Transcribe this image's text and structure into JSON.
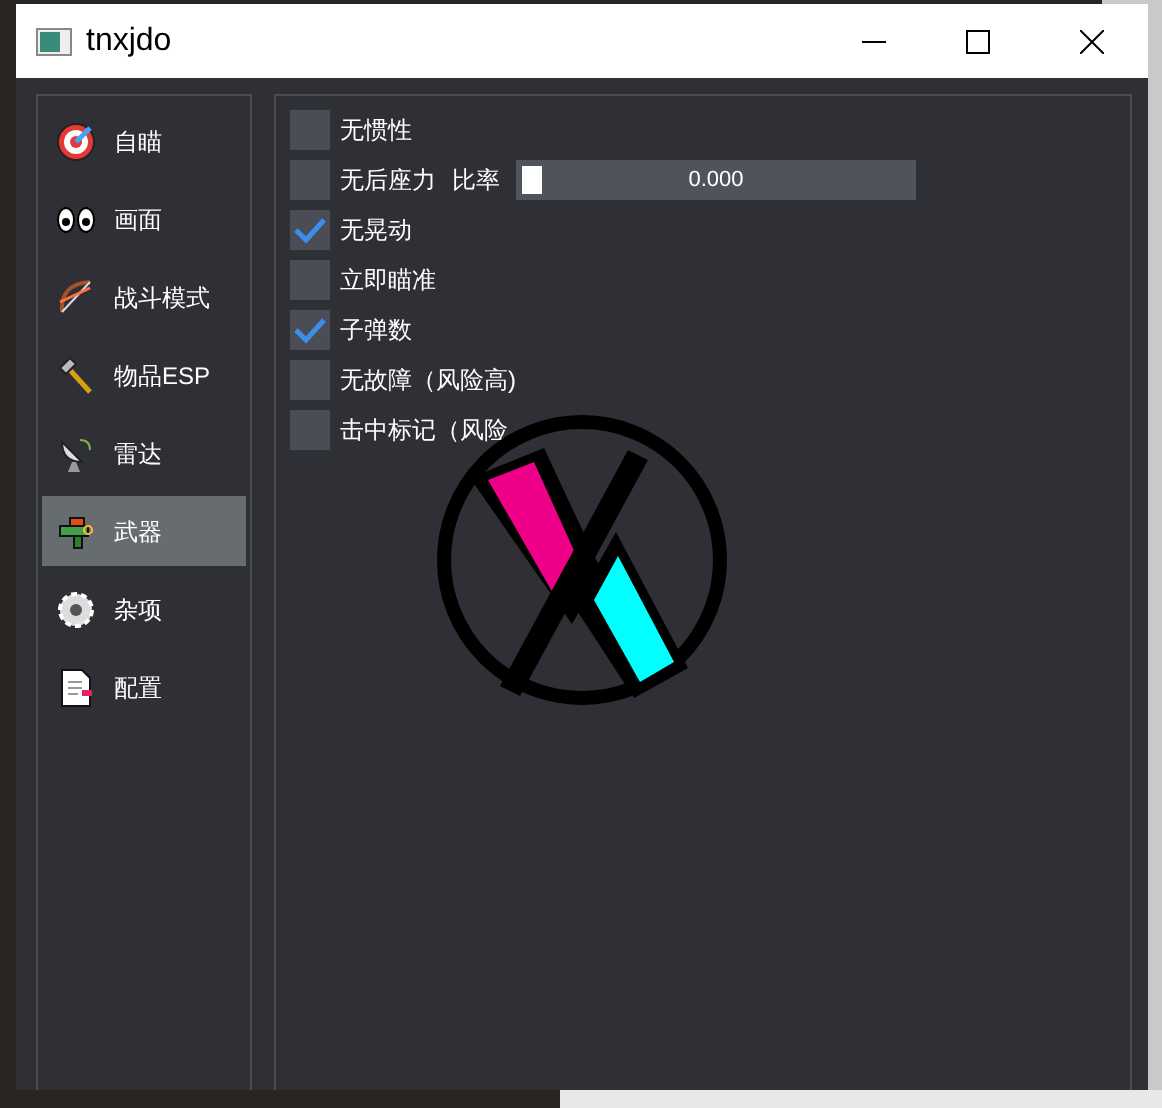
{
  "window": {
    "title": "tnxjdo"
  },
  "sidebar": {
    "items": [
      {
        "label": "自瞄",
        "selected": false
      },
      {
        "label": "画面",
        "selected": false
      },
      {
        "label": "战斗模式",
        "selected": false
      },
      {
        "label": "物品ESP",
        "selected": false
      },
      {
        "label": "雷达",
        "selected": false
      },
      {
        "label": "武器",
        "selected": true
      },
      {
        "label": "杂项",
        "selected": false
      },
      {
        "label": "配置",
        "selected": false
      }
    ]
  },
  "options": [
    {
      "label": "无惯性",
      "checked": false
    },
    {
      "label": "无后座力",
      "checked": false,
      "slider": {
        "label": "比率",
        "level": 0,
        "reading": "0.000"
      }
    },
    {
      "label": "无晃动",
      "checked": true
    },
    {
      "label": "立即瞄准",
      "checked": false
    },
    {
      "label": "子弹数",
      "checked": true
    },
    {
      "label": "无故障（风险高)",
      "checked": false
    },
    {
      "label": "击中标记（风险",
      "checked": false
    }
  ]
}
